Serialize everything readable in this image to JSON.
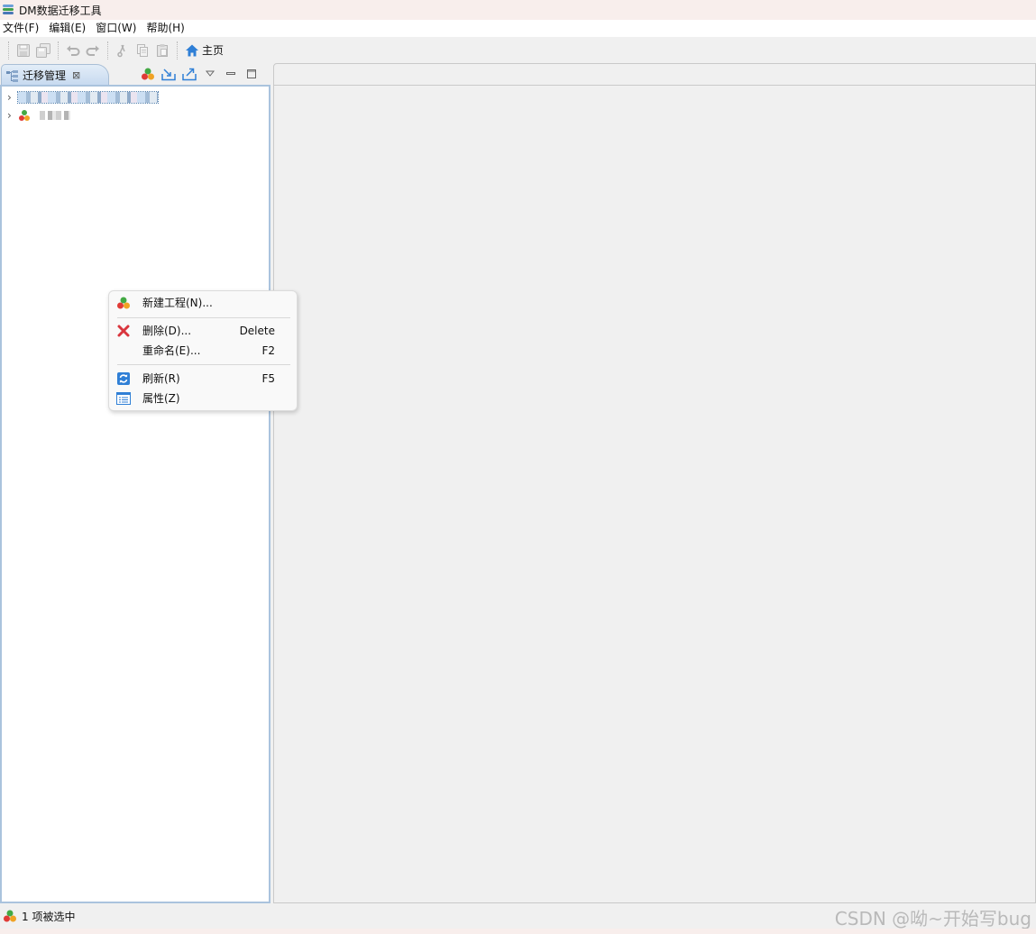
{
  "window": {
    "title": "DM数据迁移工具"
  },
  "menubar": {
    "items": [
      "文件(F)",
      "编辑(E)",
      "窗口(W)",
      "帮助(H)"
    ]
  },
  "toolbar": {
    "home_label": "主页",
    "accent": "#2f7fd6"
  },
  "view": {
    "tab_label": "迁移管理",
    "border_color": "#aac3dd"
  },
  "context_menu": {
    "items": [
      {
        "label": "新建工程(N)...",
        "shortcut": "",
        "icon": "project-icon"
      },
      {
        "label": "删除(D)...",
        "shortcut": "Delete",
        "icon": "delete-icon"
      },
      {
        "label": "重命名(E)...",
        "shortcut": "F2",
        "icon": ""
      },
      {
        "label": "刷新(R)",
        "shortcut": "F5",
        "icon": "refresh-icon"
      },
      {
        "label": "属性(Z)",
        "shortcut": "",
        "icon": "properties-icon"
      }
    ]
  },
  "statusbar": {
    "text": "1 项被选中"
  },
  "watermark": {
    "text": "CSDN @呦~开始写bug"
  }
}
